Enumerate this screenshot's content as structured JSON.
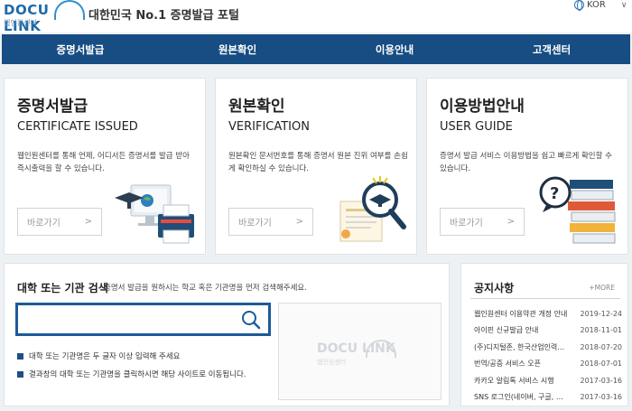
{
  "header": {
    "logo_text": "DOCU LINK",
    "logo_sub": "웹인원센터",
    "tagline": "대한민국 No.1 증명발급 포털",
    "lang_label": "KOR",
    "lang_chevron": "∨"
  },
  "nav": {
    "items": [
      {
        "label": "증명서발급"
      },
      {
        "label": "원본확인"
      },
      {
        "label": "이용안내"
      },
      {
        "label": "고객센터"
      }
    ]
  },
  "cards": [
    {
      "title": "증명서발급",
      "subtitle": "CERTIFICATE ISSUED",
      "desc": "웹인원센터를 통해 언제, 어디서든 증명서를 발급 받아 즉시출력을 할 수 있습니다.",
      "button": "바로가기",
      "arrow": ">"
    },
    {
      "title": "원본확인",
      "subtitle": "VERIFICATION",
      "desc": "원본확인 문서번호를 통해 증명서 원본 진위 여부를 손쉽게 확인하실 수 있습니다.",
      "button": "바로가기",
      "arrow": ">"
    },
    {
      "title": "이용방법안내",
      "subtitle": "USER GUIDE",
      "desc": "증명서 발급 서비스 이용방법을 쉽고 빠르게 확인할 수 있습니다.",
      "button": "바로가기",
      "arrow": ">"
    }
  ],
  "search": {
    "title": "대학 또는 기관 검색",
    "hint": "증명서 발급을 원하시는 학교 혹은 기관명을 먼저 검색해주세요.",
    "value": "",
    "placeholder": "",
    "tips": [
      "대학 또는 기관명은 두 글자 이상 입력해 주세요",
      "결과창의 대학 또는 기관명을 클릭하시면 해당 사이트로 이동됩니다."
    ],
    "result_logo": "DOCU LINK",
    "result_logo_sub": "웹인원센터"
  },
  "notice": {
    "title": "공지사항",
    "more": "+MORE",
    "items": [
      {
        "title": "웹인원센터 이용약관 개정 안내",
        "date": "2019-12-24"
      },
      {
        "title": "아이핀 신규발급 안내",
        "date": "2018-11-01"
      },
      {
        "title": "(주)디지털존, 한국산업인력공단 제휴",
        "date": "2018-07-20"
      },
      {
        "title": "번역/공증 서비스 오픈",
        "date": "2018-07-01"
      },
      {
        "title": "카카오 알림톡 서비스 시행",
        "date": "2017-03-16"
      },
      {
        "title": "SNS 로그인(네이버, 구글, 카카오)",
        "date": "2017-03-16"
      }
    ]
  },
  "colors": {
    "nav_bg": "#174d83",
    "accent": "#1d5a98",
    "brand": "#1d6aa8"
  }
}
